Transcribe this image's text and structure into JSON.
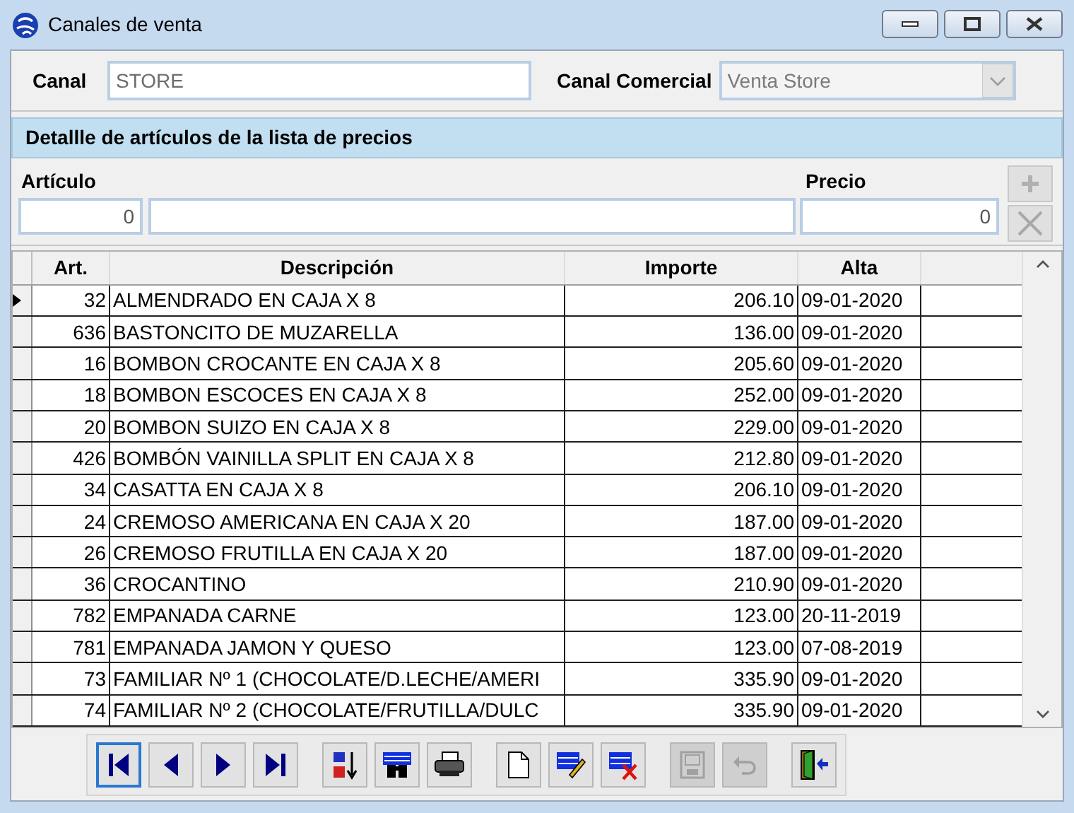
{
  "window": {
    "title": "Canales de venta"
  },
  "canal": {
    "label": "Canal",
    "value": "STORE"
  },
  "canal_comercial": {
    "label": "Canal Comercial",
    "value": "Venta Store",
    "disabled": true
  },
  "section_title": "Detallle de artículos de la lista de precios",
  "entry": {
    "articulo_label": "Artículo",
    "precio_label": "Precio",
    "articulo_value": "0",
    "precio_value": "0",
    "add_disabled": true,
    "remove_disabled": true
  },
  "table": {
    "columns": [
      "Art.",
      "Descripción",
      "Importe",
      "Alta"
    ],
    "rows": [
      {
        "art": "32",
        "descripcion": "ALMENDRADO EN CAJA X 8",
        "importe": "206.10",
        "alta": "09-01-2020",
        "selected": true
      },
      {
        "art": "636",
        "descripcion": "BASTONCITO DE MUZARELLA",
        "importe": "136.00",
        "alta": "09-01-2020",
        "selected": false
      },
      {
        "art": "16",
        "descripcion": "BOMBON CROCANTE EN CAJA X 8",
        "importe": "205.60",
        "alta": "09-01-2020",
        "selected": false
      },
      {
        "art": "18",
        "descripcion": "BOMBON ESCOCES EN CAJA X 8",
        "importe": "252.00",
        "alta": "09-01-2020",
        "selected": false
      },
      {
        "art": "20",
        "descripcion": "BOMBON SUIZO EN CAJA X 8",
        "importe": "229.00",
        "alta": "09-01-2020",
        "selected": false
      },
      {
        "art": "426",
        "descripcion": "BOMBÓN VAINILLA SPLIT EN CAJA X 8",
        "importe": "212.80",
        "alta": "09-01-2020",
        "selected": false
      },
      {
        "art": "34",
        "descripcion": "CASATTA EN CAJA X 8",
        "importe": "206.10",
        "alta": "09-01-2020",
        "selected": false
      },
      {
        "art": "24",
        "descripcion": "CREMOSO AMERICANA EN CAJA X 20",
        "importe": "187.00",
        "alta": "09-01-2020",
        "selected": false
      },
      {
        "art": "26",
        "descripcion": "CREMOSO FRUTILLA EN CAJA X 20",
        "importe": "187.00",
        "alta": "09-01-2020",
        "selected": false
      },
      {
        "art": "36",
        "descripcion": "CROCANTINO",
        "importe": "210.90",
        "alta": "09-01-2020",
        "selected": false
      },
      {
        "art": "782",
        "descripcion": "EMPANADA CARNE",
        "importe": "123.00",
        "alta": "20-11-2019",
        "selected": false
      },
      {
        "art": "781",
        "descripcion": "EMPANADA JAMON Y QUESO",
        "importe": "123.00",
        "alta": "07-08-2019",
        "selected": false
      },
      {
        "art": "73",
        "descripcion": "FAMILIAR Nº 1 (CHOCOLATE/D.LECHE/AMERI",
        "importe": "335.90",
        "alta": "09-01-2020",
        "selected": false
      },
      {
        "art": "74",
        "descripcion": "FAMILIAR Nº 2 (CHOCOLATE/FRUTILLA/DULC",
        "importe": "335.90",
        "alta": "09-01-2020",
        "selected": false
      }
    ]
  },
  "toolbar": [
    {
      "kind": "first",
      "disabled": false,
      "focused": true
    },
    {
      "kind": "prev",
      "disabled": false,
      "focused": false
    },
    {
      "kind": "next",
      "disabled": false,
      "focused": false
    },
    {
      "kind": "last",
      "disabled": false,
      "focused": false
    },
    {
      "kind": "sort",
      "disabled": false,
      "focused": false
    },
    {
      "kind": "find",
      "disabled": false,
      "focused": false
    },
    {
      "kind": "print",
      "disabled": false,
      "focused": false
    },
    {
      "kind": "new",
      "disabled": false,
      "focused": false
    },
    {
      "kind": "edit",
      "disabled": false,
      "focused": false
    },
    {
      "kind": "delete",
      "disabled": false,
      "focused": false
    },
    {
      "kind": "save",
      "disabled": true,
      "focused": false
    },
    {
      "kind": "undo",
      "disabled": true,
      "focused": false
    },
    {
      "kind": "exit",
      "disabled": false,
      "focused": false
    }
  ]
}
